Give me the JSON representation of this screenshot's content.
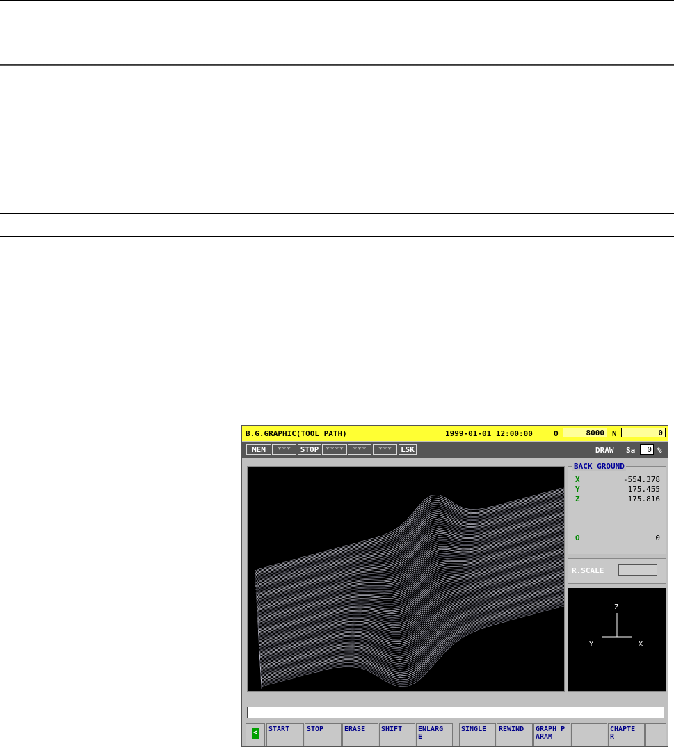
{
  "screen": {
    "title": "B.G.GRAPHIC(TOOL PATH)",
    "datetime": "1999-01-01 12:00:00",
    "o_label": "O",
    "o_value": "8000",
    "n_label": "N",
    "n_value": "0"
  },
  "status": {
    "mode": "MEM",
    "f1": "***",
    "state": "STOP",
    "f2": "****",
    "f3": "***",
    "f4": "***",
    "lsk": "LSK",
    "draw": "DRAW",
    "sa_label": "Sa",
    "sa_value": "0",
    "percent": "%"
  },
  "background_panel": {
    "title": "BACK GROUND",
    "rows": [
      {
        "axis": "X",
        "value": "-554.378"
      },
      {
        "axis": "Y",
        "value": "175.455"
      },
      {
        "axis": "Z",
        "value": "175.816"
      },
      {
        "axis": "O",
        "value": "0"
      }
    ]
  },
  "rscale": {
    "label": "R.SCALE"
  },
  "axes": {
    "z": "Z",
    "y": "Y",
    "x": "X"
  },
  "softkeys": [
    "START",
    "STOP",
    "ERASE",
    "SHIFT",
    "ENLARGE",
    "SINGLE",
    "REWIND",
    "GRAPH PARAM",
    "",
    "CHAPTER"
  ],
  "softkey_display": [
    "START",
    "STOP",
    "ERASE",
    "SHIFT",
    "ENLARG E",
    "SINGLE",
    "REWIND",
    "GRAPH PARAM",
    "",
    "CHAPTE R"
  ],
  "back_key": "<",
  "colors": {
    "title_bg": "#ffff33",
    "status_bg": "#555555",
    "axis_label": "#008800",
    "softkey_text": "#000088"
  }
}
